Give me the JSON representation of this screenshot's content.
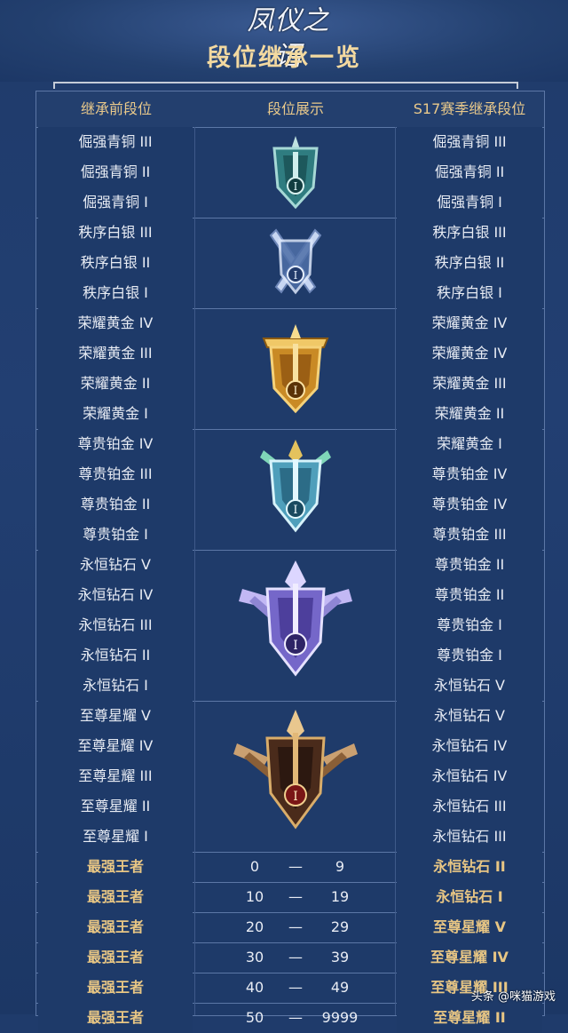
{
  "logo_text": "凤仪之诏",
  "title": "段位继承一览",
  "headers": {
    "before": "继承前段位",
    "display": "段位展示",
    "after": "S17赛季继承段位"
  },
  "rows": [
    {
      "before": "倔强青铜 III",
      "after": "倔强青铜 III"
    },
    {
      "before": "倔强青铜 II",
      "after": "倔强青铜 II"
    },
    {
      "before": "倔强青铜 I",
      "after": "倔强青铜 I"
    },
    {
      "before": "秩序白银 III",
      "after": "秩序白银 III"
    },
    {
      "before": "秩序白银 II",
      "after": "秩序白银 II"
    },
    {
      "before": "秩序白银 I",
      "after": "秩序白银 I"
    },
    {
      "before": "荣耀黄金 IV",
      "after": "荣耀黄金 IV"
    },
    {
      "before": "荣耀黄金 III",
      "after": "荣耀黄金 IV"
    },
    {
      "before": "荣耀黄金 II",
      "after": "荣耀黄金 III"
    },
    {
      "before": "荣耀黄金 I",
      "after": "荣耀黄金 II"
    },
    {
      "before": "尊贵铂金 IV",
      "after": "荣耀黄金 I"
    },
    {
      "before": "尊贵铂金 III",
      "after": "尊贵铂金 IV"
    },
    {
      "before": "尊贵铂金 II",
      "after": "尊贵铂金 IV"
    },
    {
      "before": "尊贵铂金 I",
      "after": "尊贵铂金 III"
    },
    {
      "before": "永恒钻石 V",
      "after": "尊贵铂金 II"
    },
    {
      "before": "永恒钻石 IV",
      "after": "尊贵铂金 II"
    },
    {
      "before": "永恒钻石 III",
      "after": "尊贵铂金 I"
    },
    {
      "before": "永恒钻石 II",
      "after": "尊贵铂金 I"
    },
    {
      "before": "永恒钻石 I",
      "after": "永恒钻石 V"
    },
    {
      "before": "至尊星耀 V",
      "after": "永恒钻石 V"
    },
    {
      "before": "至尊星耀 IV",
      "after": "永恒钻石 IV"
    },
    {
      "before": "至尊星耀 III",
      "after": "永恒钻石 IV"
    },
    {
      "before": "至尊星耀 II",
      "after": "永恒钻石 III"
    },
    {
      "before": "至尊星耀 I",
      "after": "永恒钻石 III"
    }
  ],
  "king_rows": [
    {
      "before": "最强王者",
      "low": "0",
      "dash": "—",
      "high": "9",
      "after": "永恒钻石 II"
    },
    {
      "before": "最强王者",
      "low": "10",
      "dash": "—",
      "high": "19",
      "after": "永恒钻石 I"
    },
    {
      "before": "最强王者",
      "low": "20",
      "dash": "—",
      "high": "29",
      "after": "至尊星耀 V"
    },
    {
      "before": "最强王者",
      "low": "30",
      "dash": "—",
      "high": "39",
      "after": "至尊星耀 IV"
    },
    {
      "before": "最强王者",
      "low": "40",
      "dash": "—",
      "high": "49",
      "after": "至尊星耀 III"
    },
    {
      "before": "最强王者",
      "low": "50",
      "dash": "—",
      "high": "9999",
      "after": "至尊星耀 II"
    }
  ],
  "emblems": [
    {
      "tier": "bronze",
      "icon": "bronze-emblem-icon",
      "numeral": "I",
      "color": "#4a9a9c"
    },
    {
      "tier": "silver",
      "icon": "silver-emblem-icon",
      "numeral": "I",
      "color": "#8aa6d8"
    },
    {
      "tier": "gold",
      "icon": "gold-emblem-icon",
      "numeral": "I",
      "color": "#d9a13a"
    },
    {
      "tier": "platinum",
      "icon": "platinum-emblem-icon",
      "numeral": "I",
      "color": "#6fc1d6"
    },
    {
      "tier": "diamond",
      "icon": "diamond-emblem-icon",
      "numeral": "I",
      "color": "#9a8ee6"
    },
    {
      "tier": "starlight",
      "icon": "starlight-emblem-icon",
      "numeral": "I",
      "color": "#8a5a38"
    }
  ],
  "watermark": "头条 @咪猫游戏"
}
